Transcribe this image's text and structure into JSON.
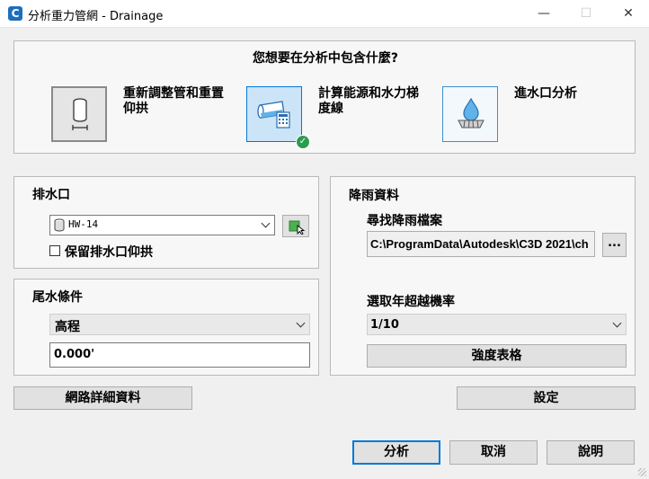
{
  "window": {
    "icon_letter": "C",
    "title": "分析重力管網 - Drainage",
    "minimize": "—",
    "maximize": "☐",
    "close": "✕"
  },
  "question": "您想要在分析中包含什麼?",
  "options": [
    {
      "label_line1": "重新調整管和重置",
      "label_line2": "仰拱",
      "icon": "pipe-resize-icon",
      "selected": false
    },
    {
      "label_line1": "計算能源和水力梯",
      "label_line2": "度線",
      "icon": "energy-hydraulic-icon",
      "selected": true
    },
    {
      "label_line1": "進水口分析",
      "label_line2": "",
      "icon": "inlet-drop-icon",
      "selected": false
    }
  ],
  "outfall": {
    "heading": "排水口",
    "selected": "HW-14",
    "checkbox_label": "保留排水口仰拱",
    "checkbox_checked": false
  },
  "tailwater": {
    "heading": "尾水條件",
    "selected": "高程",
    "value": "0.000'"
  },
  "rainfall": {
    "heading": "降雨資料",
    "find_label": "尋找降雨檔案",
    "file_path": "C:\\ProgramData\\Autodesk\\C3D 2021\\ch",
    "browse_label": "...",
    "return_period_label": "選取年超越機率",
    "return_period_value": "1/10",
    "intensity_button": "強度表格"
  },
  "buttons": {
    "network_details": "網路詳細資料",
    "settings": "設定",
    "analyze": "分析",
    "cancel": "取消",
    "help": "說明"
  },
  "colors": {
    "accent": "#0078d7",
    "selected_bg": "#cce4f7",
    "check_green": "#2e9b4e"
  }
}
